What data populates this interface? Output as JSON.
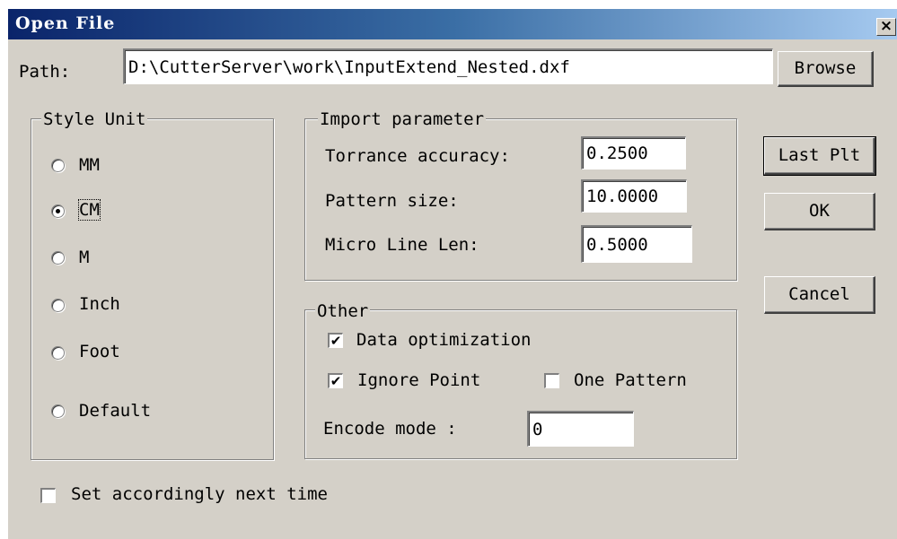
{
  "dialog": {
    "title": "Open File",
    "close_glyph": "×"
  },
  "path": {
    "label": "Path:",
    "value": "D:\\CutterServer\\work\\InputExtend_Nested.dxf",
    "browse_label": "Browse"
  },
  "style_unit": {
    "legend": "Style Unit",
    "options": [
      {
        "label": "MM",
        "selected": false
      },
      {
        "label": "CM",
        "selected": true
      },
      {
        "label": "M",
        "selected": false
      },
      {
        "label": "Inch",
        "selected": false
      },
      {
        "label": "Foot",
        "selected": false
      },
      {
        "label": "Default",
        "selected": false
      }
    ]
  },
  "import_parameter": {
    "legend": "Import parameter",
    "torrance_label": "Torrance accuracy:",
    "torrance_value": "0.2500",
    "pattern_size_label": "Pattern size:",
    "pattern_size_value": "10.0000",
    "micro_line_label": "Micro Line Len:",
    "micro_line_value": "0.5000"
  },
  "other": {
    "legend": "Other",
    "data_optimization_label": "Data optimization",
    "data_optimization_checked": true,
    "ignore_point_label": "Ignore Point",
    "ignore_point_checked": true,
    "one_pattern_label": "One Pattern",
    "one_pattern_checked": false,
    "encode_mode_label": "Encode mode :",
    "encode_mode_value": "0"
  },
  "buttons": {
    "last_plt": "Last Plt",
    "ok": "OK",
    "cancel": "Cancel"
  },
  "footer": {
    "set_next_time_label": "Set accordingly next time",
    "set_next_time_checked": false
  }
}
